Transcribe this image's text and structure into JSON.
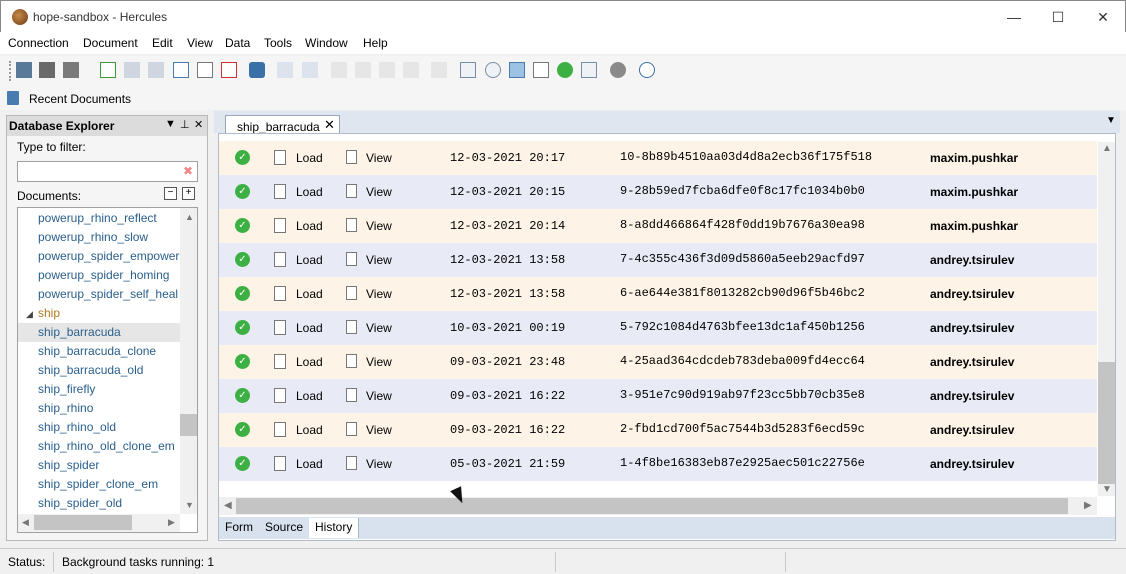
{
  "window": {
    "title": "hope-sandbox - Hercules",
    "minimize": "—",
    "maximize": "☐",
    "close": "✕"
  },
  "menu": [
    "Connection",
    "Document",
    "Edit",
    "View",
    "Data",
    "Tools",
    "Window",
    "Help"
  ],
  "recent": {
    "label": "Recent Documents"
  },
  "explorer": {
    "title": "Database Explorer",
    "filter_label": "Type to filter:",
    "filter_value": "",
    "documents_label": "Documents:",
    "items": [
      "powerup_rhino_reflect",
      "powerup_rhino_slow",
      "powerup_spider_empower",
      "powerup_spider_homing",
      "powerup_spider_self_heal",
      "ship",
      "ship_barracuda",
      "ship_barracuda_clone",
      "ship_barracuda_old",
      "ship_firefly",
      "ship_rhino",
      "ship_rhino_old",
      "ship_rhino_old_clone_em",
      "ship_spider",
      "ship_spider_clone_em",
      "ship_spider_old"
    ],
    "selected": "ship_barracuda"
  },
  "tab": {
    "title": "ship_barracuda"
  },
  "history": {
    "load_label": "Load",
    "view_label": "View",
    "rows": [
      {
        "date": "12-03-2021 20:17",
        "hash": "10-8b89b4510aa03d4d8a2ecb36f175f518",
        "user": "maxim.pushkar"
      },
      {
        "date": "12-03-2021 20:15",
        "hash": "9-28b59ed7fcba6dfe0f8c17fc1034b0b0",
        "user": "maxim.pushkar"
      },
      {
        "date": "12-03-2021 20:14",
        "hash": "8-a8dd466864f428f0dd19b7676a30ea98",
        "user": "maxim.pushkar"
      },
      {
        "date": "12-03-2021 13:58",
        "hash": "7-4c355c436f3d09d5860a5eeb29acfd97",
        "user": "andrey.tsirulev"
      },
      {
        "date": "12-03-2021 13:58",
        "hash": "6-ae644e381f8013282cb90d96f5b46bc2",
        "user": "andrey.tsirulev"
      },
      {
        "date": "10-03-2021 00:19",
        "hash": "5-792c1084d4763bfee13dc1af450b1256",
        "user": "andrey.tsirulev"
      },
      {
        "date": "09-03-2021 23:48",
        "hash": "4-25aad364cdcdeb783deba009fd4ecc64",
        "user": "andrey.tsirulev"
      },
      {
        "date": "09-03-2021 16:22",
        "hash": "3-951e7c90d919ab97f23cc5bb70cb35e8",
        "user": "andrey.tsirulev"
      },
      {
        "date": "09-03-2021 16:22",
        "hash": "2-fbd1cd700f5ac7544b3d5283f6ecd59c",
        "user": "andrey.tsirulev"
      },
      {
        "date": "05-03-2021 21:59",
        "hash": "1-4f8be16383eb87e2925aec501c22756e",
        "user": "andrey.tsirulev"
      }
    ]
  },
  "bottom_tabs": [
    "Form",
    "Source",
    "History"
  ],
  "active_bottom_tab": "History",
  "status": {
    "label": "Status:",
    "message": "Background tasks running: 1"
  },
  "colors": {
    "ok_green": "#3cb043",
    "row_odd": "#fdf3e6",
    "row_even": "#e8eaf6"
  }
}
